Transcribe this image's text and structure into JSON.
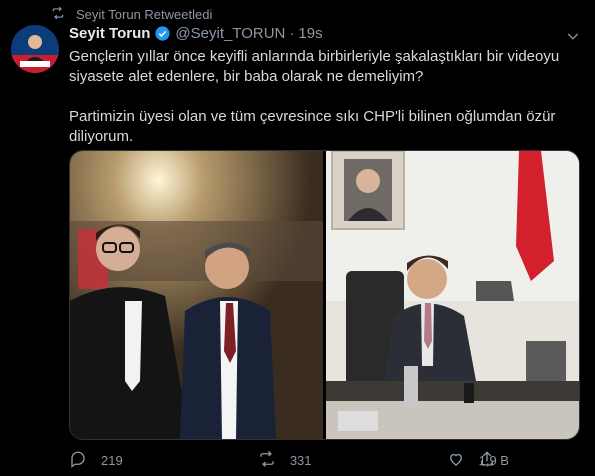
{
  "retweet": {
    "icon": "retweet-icon",
    "label": "Seyit Torun Retweetledi"
  },
  "tweet": {
    "author_name": "Seyit Torun",
    "handle": "@Seyit_TORUN",
    "separator": "·",
    "time": "19s",
    "paragraph1": "Gençlerin yıllar önce keyifli anlarında birbirleriyle şakalaştıkları bir videoyu siyasete alet edenlere, bir baba olarak ne demeliyim?",
    "paragraph2": "Partimizin üyesi olan ve tüm çevresince sıkı CHP'li bilinen oğlumdan özür diliyorum."
  },
  "actions": {
    "replies": "219",
    "retweets": "331",
    "likes": "1,9 B"
  },
  "colors": {
    "background": "#000000",
    "muted": "#8b98a5",
    "verified": "#1d9bf0",
    "text": "#d9d9d9"
  }
}
